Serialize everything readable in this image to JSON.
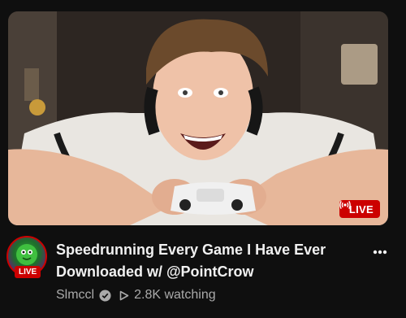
{
  "video": {
    "title_line1": "Speedrunning Every Game I Have Ever",
    "title_line2": "Downloaded w/ @PointCrow",
    "channel": "Slmccl",
    "viewers": "2.8K watching",
    "live_badge": "LIVE",
    "avatar_live_badge": "LIVE"
  },
  "icons": {
    "live_indicator": "broadcast-icon",
    "verified": "verified-check-icon",
    "play": "play-outline-icon",
    "more": "more-vert-icon"
  },
  "colors": {
    "background": "#0f0f0f",
    "live_red": "#cc0000",
    "title_text": "#f1f1f1",
    "secondary_text": "#aaaaaa"
  }
}
